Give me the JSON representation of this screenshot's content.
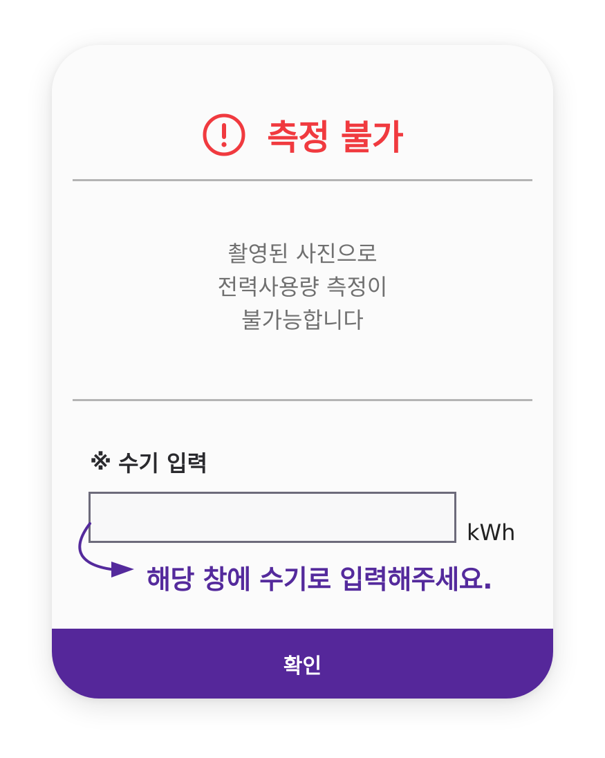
{
  "dialog": {
    "title": "측정 불가",
    "title_color": "#f03a3f",
    "icon": "alert-circle-icon",
    "message_lines": [
      "촬영된 사진으로",
      "전력사용량 측정이",
      "불가능합니다"
    ]
  },
  "manual_input": {
    "mark": "※",
    "label": "수기 입력",
    "value": "",
    "placeholder": "",
    "unit": "kWh",
    "hint": "해당 창에 수기로 입력해주세요.",
    "hint_icon": "curved-arrow-icon"
  },
  "confirm_button": {
    "label": "확인",
    "color": "#55279a"
  }
}
